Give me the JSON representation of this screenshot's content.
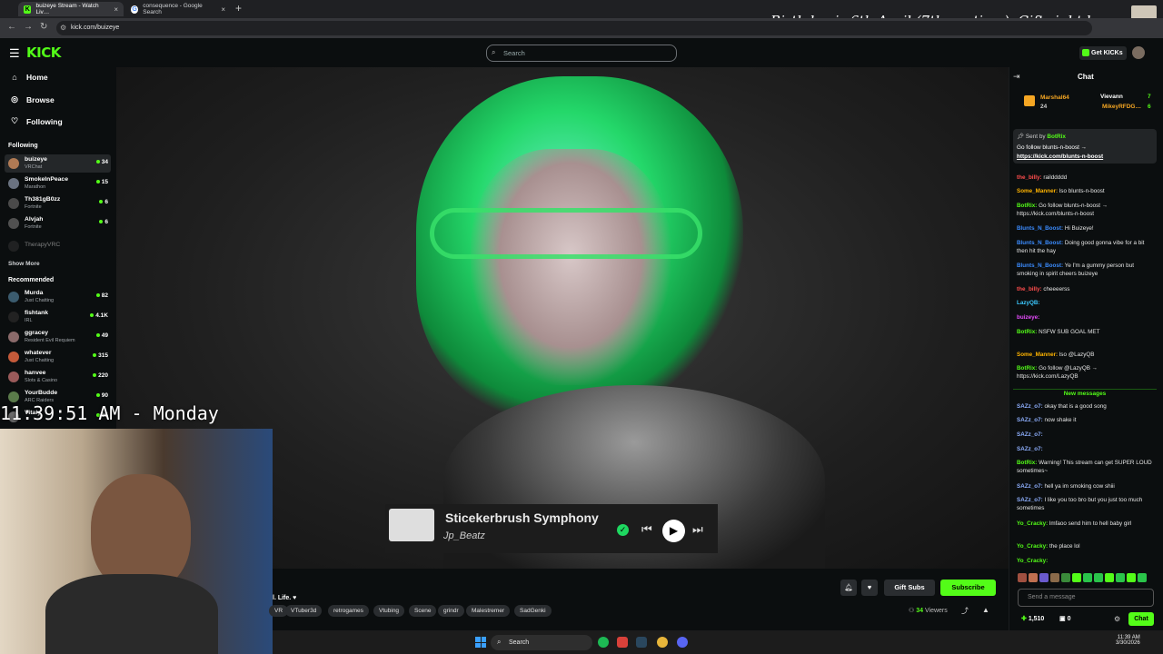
{
  "browser": {
    "tabs": [
      {
        "title": "buizeye Stream - Watch Liv…",
        "close": "×"
      },
      {
        "title": "consequence - Google Search",
        "close": "×"
      }
    ],
    "new_tab": "+",
    "url": "kick.com/buizeye",
    "nav": {
      "back": "←",
      "forward": "→",
      "reload": "↻"
    }
  },
  "overlay": {
    "message": "Birthday is 6th April (7th my time), Gift right here",
    "clock": "11:39:51 AM - Monday"
  },
  "header": {
    "logo": "KICK",
    "search_placeholder": "Search",
    "get_kicks": "Get KICKs"
  },
  "sidebar": {
    "nav": [
      {
        "label": "Home",
        "icon": "home-icon"
      },
      {
        "label": "Browse",
        "icon": "compass-icon"
      },
      {
        "label": "Following",
        "icon": "heart-icon"
      }
    ],
    "following_title": "Following",
    "following": [
      {
        "name": "buizeye",
        "game": "VRChat",
        "viewers": "34",
        "color": "#b07a54"
      },
      {
        "name": "SmokeInPeace",
        "game": "Marathon",
        "viewers": "15",
        "color": "#6a7280"
      },
      {
        "name": "Th381gB0zz",
        "game": "Fortnite",
        "viewers": "6",
        "color": "#4a4a4a"
      },
      {
        "name": "Alvjah",
        "game": "Fortnite",
        "viewers": "6",
        "color": "#505050"
      },
      {
        "name": "TherapyVRC",
        "game": "",
        "viewers": "",
        "color": "#3a3a3a"
      }
    ],
    "show_more": "Show More",
    "recommended_title": "Recommended",
    "recommended": [
      {
        "name": "Murda",
        "game": "Just Chatting",
        "viewers": "82",
        "color": "#3b5b6e"
      },
      {
        "name": "fishtank",
        "game": "IRL",
        "viewers": "4.1K",
        "color": "#222"
      },
      {
        "name": "ggracey",
        "game": "Resident Evil Requiem",
        "viewers": "49",
        "color": "#8a6a6a"
      },
      {
        "name": "whatever",
        "game": "Just Chatting",
        "viewers": "315",
        "color": "#c45a3a"
      },
      {
        "name": "hanvee",
        "game": "Slots & Casino",
        "viewers": "220",
        "color": "#9a5a5a"
      },
      {
        "name": "YourBudde",
        "game": "ARC Raiders",
        "viewers": "90",
        "color": "#5a7a4a"
      },
      {
        "name": "Vitaly",
        "game": "",
        "viewers": "35",
        "color": "#6a6a6a"
      }
    ]
  },
  "player": {
    "song_title": "Sticekerbrush Symphony",
    "song_artist": "Jp_Beatz",
    "controls": {
      "prev": "⏮",
      "play": "▶",
      "next": "⏭",
      "check": "✓"
    }
  },
  "stream": {
    "title": "l. Life. ♥",
    "tags": [
      "VR",
      "VTuber3d",
      "retrogames",
      "Vtubing",
      "Scene",
      "grindr",
      "Malestremer",
      "SadGenki"
    ],
    "gift_subs": "Gift Subs",
    "subscribe": "Subscribe",
    "viewers_count": "34",
    "viewers_label": "Viewers"
  },
  "taskbar": {
    "search": "Search",
    "time": "11:39 AM",
    "date": "3/30/2026"
  },
  "chat": {
    "title": "Chat",
    "leaderboard": [
      {
        "name": "Marshal64",
        "value": "24",
        "color": "#f5a623"
      },
      {
        "name": "Vievann",
        "value": "7",
        "color": "#ffffff"
      },
      {
        "name": "MikeyRFDG…",
        "value": "6",
        "color": "#f5a623"
      }
    ],
    "pinned": {
      "sent_by": "Sent by",
      "author": "BotRix",
      "text": "Go follow blunts-n-boost →",
      "link": "https://kick.com/blunts-n-boost"
    },
    "messages": [
      {
        "user": "the_billy:",
        "text": "railddddd",
        "color": "#ff4d4d"
      },
      {
        "user": "Some_Manner:",
        "text": "lso blunts-n-boost",
        "color": "#ffb400"
      },
      {
        "user": "BotRix:",
        "text": "Go follow blunts-n-boost → https://kick.com/blunts-n-boost",
        "color": "#53fc18"
      },
      {
        "user": "Blunts_N_Boost:",
        "text": "Hi Buizeye!",
        "color": "#3b8cff"
      },
      {
        "user": "Blunts_N_Boost:",
        "text": "Doing good gonna vibe for a bit then hit the hay",
        "color": "#3b8cff"
      },
      {
        "user": "Blunts_N_Boost:",
        "text": "Ye I'm a gummy person but smoking in spirit cheers buizeye",
        "color": "#3b8cff"
      },
      {
        "user": "the_billy:",
        "text": "cheeeerss",
        "color": "#ff4d4d"
      },
      {
        "user": "LazyQB:",
        "text": "",
        "color": "#3bc9ff"
      },
      {
        "user": "buizeye:",
        "text": "",
        "color": "#e84cff"
      },
      {
        "user": "BotRix:",
        "text": "NSFW SUB GOAL MET",
        "color": "#53fc18"
      },
      {
        "user": "Some_Manner:",
        "text": "lso @LazyQB",
        "color": "#ffb400"
      },
      {
        "user": "BotRix:",
        "text": "Go follow @LazyQB → https://kick.com/LazyQB",
        "color": "#53fc18"
      }
    ],
    "new_messages": "New messages",
    "messages_new": [
      {
        "user": "SAZz_o7:",
        "text": "okay that is a good song",
        "color": "#8fb0ff"
      },
      {
        "user": "SAZz_o7:",
        "text": "now shake it",
        "color": "#8fb0ff"
      },
      {
        "user": "SAZz_o7:",
        "text": "",
        "color": "#8fb0ff"
      },
      {
        "user": "SAZz_o7:",
        "text": "",
        "color": "#8fb0ff"
      },
      {
        "user": "BotRix:",
        "text": "Warning! This stream can get SUPER LOUD sometimes~",
        "color": "#53fc18"
      },
      {
        "user": "SAZz_o7:",
        "text": "hell ya im smoking cow shiii",
        "color": "#8fb0ff"
      },
      {
        "user": "SAZz_o7:",
        "text": "I like you too bro but you just too much sometimes",
        "color": "#8fb0ff"
      },
      {
        "user": "Yo_Cracky:",
        "text": "lmfaoo send him to hell baby girl",
        "color": "#53fc18"
      },
      {
        "user": "Yo_Cracky:",
        "text": "the place lol",
        "color": "#53fc18"
      },
      {
        "user": "Yo_Cracky:",
        "text": "",
        "color": "#53fc18"
      }
    ],
    "input_placeholder": "Send a message",
    "points": "1,510",
    "second_count": "0",
    "chat_button": "Chat"
  }
}
